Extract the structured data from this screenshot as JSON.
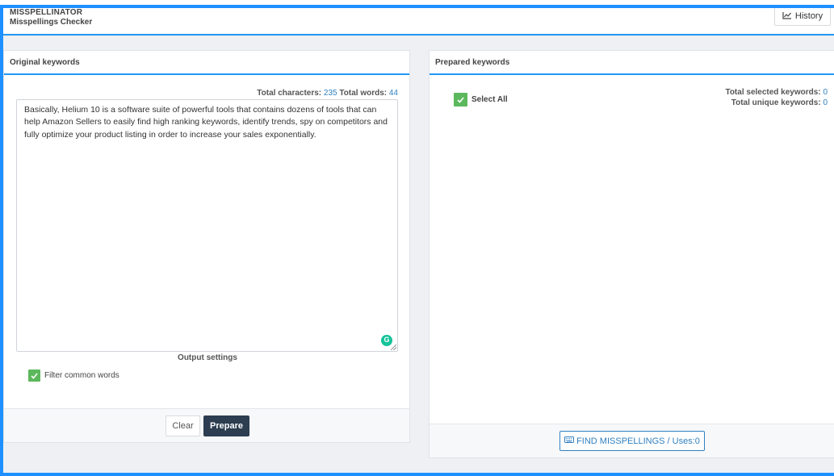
{
  "app": {
    "name": "MISSPELLINATOR",
    "subtitle": "Misspellings Checker",
    "history_label": "History"
  },
  "left_panel": {
    "title": "Original keywords",
    "total_characters_label": "Total characters:",
    "total_characters": "235",
    "total_words_label": "Total words:",
    "total_words": "44",
    "text": "Basically, Helium 10 is a software suite of powerful tools that contains dozens of tools that can help Amazon Sellers to easily find high ranking keywords, identify trends, spy on competitors and fully optimize your product listing in order to increase your sales exponentially.",
    "grammarly_glyph": "G",
    "output_settings": "Output settings",
    "filter_label": "Filter common words",
    "filter_checked": true,
    "clear_label": "Clear",
    "prepare_label": "Prepare"
  },
  "right_panel": {
    "title": "Prepared keywords",
    "select_all_label": "Select All",
    "select_all_checked": true,
    "total_selected_label": "Total selected keywords:",
    "total_selected": "0",
    "total_unique_label": "Total unique keywords:",
    "total_unique": "0",
    "find_label": "FIND MISSPELLINGS / Uses:0"
  },
  "icons": {
    "history": "chart-line-icon",
    "keyboard": "keyboard-icon",
    "check": "check-icon",
    "grammarly": "grammarly-icon"
  },
  "colors": {
    "accent": "#2196f3",
    "check": "#5cb85c",
    "primary_button": "#2c3e50",
    "link": "#2f7fc0"
  }
}
